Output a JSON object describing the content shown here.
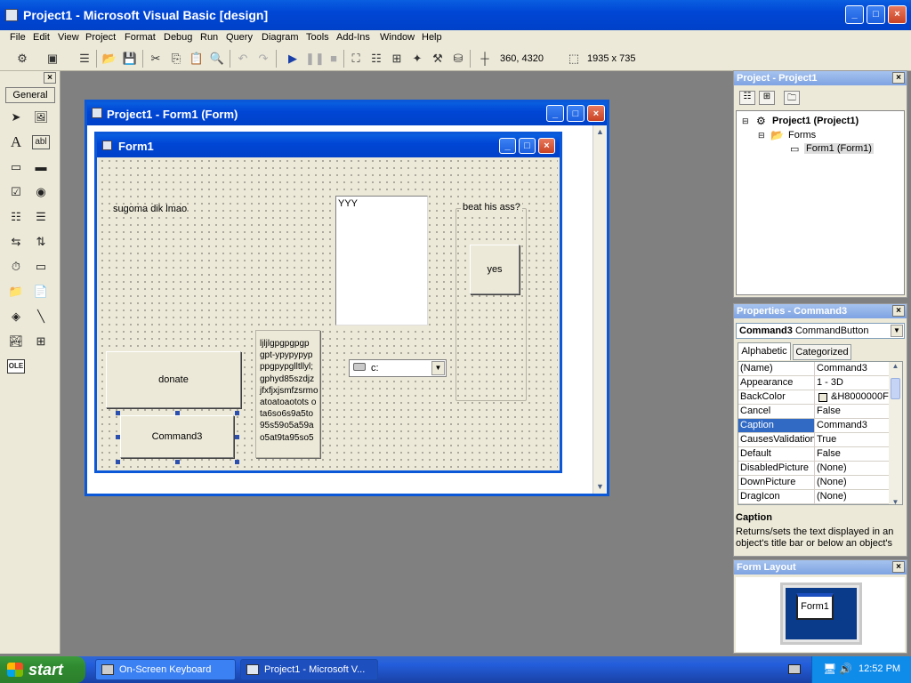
{
  "window": {
    "title": "Project1 - Microsoft Visual Basic [design]"
  },
  "menu": [
    "File",
    "Edit",
    "View",
    "Project",
    "Format",
    "Debug",
    "Run",
    "Query",
    "Diagram",
    "Tools",
    "Add-Ins",
    "Window",
    "Help"
  ],
  "toolbar": {
    "position": "360, 4320",
    "size": "1935 x 735"
  },
  "toolbox": {
    "tab": "General"
  },
  "designer": {
    "title": "Project1 - Form1 (Form)"
  },
  "form": {
    "title": "Form1",
    "label1": "sugoma dik lmao",
    "listbox_item": "YYY",
    "frame_caption": "beat his ass?",
    "yes_button": "yes",
    "donate_button": "donate",
    "command3_button": "Command3",
    "textbox_lines": [
      "ljljlgpgpgpgp",
      "gpt-ypypypyp",
      "ppgpypglltllyl;",
      "gphyd85szdjz",
      "jfxfjxjsmfzsrmo",
      "atoatoaotots o",
      "ta6so6s9a5to",
      "95s59o5a59a",
      "o5at9ta95so5"
    ],
    "drive_value": "c:"
  },
  "project_panel": {
    "title": "Project - Project1",
    "tree": {
      "root": "Project1 (Project1)",
      "folder": "Forms",
      "form": "Form1 (Form1)"
    }
  },
  "properties_panel": {
    "title": "Properties - Command3",
    "object_name": "Command3",
    "object_type": "CommandButton",
    "tabs": [
      "Alphabetic",
      "Categorized"
    ],
    "rows": [
      {
        "name": "(Name)",
        "value": "Command3"
      },
      {
        "name": "Appearance",
        "value": "1 - 3D"
      },
      {
        "name": "BackColor",
        "value": "&H8000000F"
      },
      {
        "name": "Cancel",
        "value": "False"
      },
      {
        "name": "Caption",
        "value": "Command3"
      },
      {
        "name": "CausesValidation",
        "value": "True"
      },
      {
        "name": "Default",
        "value": "False"
      },
      {
        "name": "DisabledPicture",
        "value": "(None)"
      },
      {
        "name": "DownPicture",
        "value": "(None)"
      },
      {
        "name": "DragIcon",
        "value": "(None)"
      }
    ],
    "desc_title": "Caption",
    "desc_text": "Returns/sets the text displayed in an object's title bar or below an object's"
  },
  "layout_panel": {
    "title": "Form Layout",
    "form_label": "Form1"
  },
  "taskbar": {
    "start": "start",
    "tasks": [
      "On-Screen Keyboard",
      "Project1 - Microsoft V..."
    ],
    "clock": "12:52 PM"
  },
  "colors": {
    "xp_blue": "#0046d5",
    "face": "#ece9d8",
    "selection": "#316ac5"
  }
}
